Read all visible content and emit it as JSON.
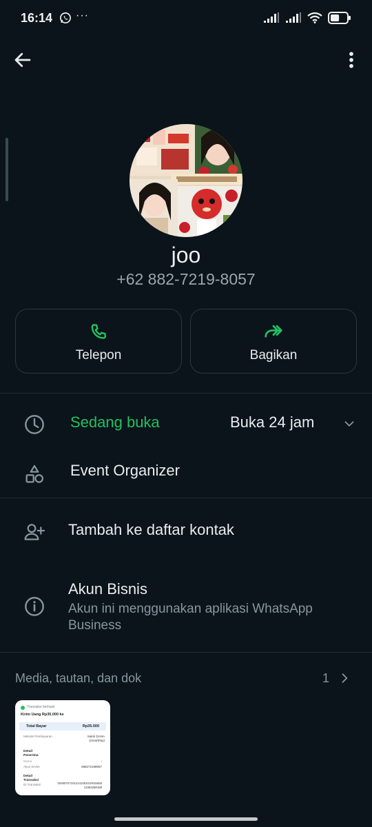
{
  "status": {
    "time": "16:14",
    "dots": "···",
    "battery_percent": 55
  },
  "contact": {
    "name": "joo",
    "phone": "+62 882-7219-8057"
  },
  "actions": {
    "call_label": "Telepon",
    "share_label": "Bagikan"
  },
  "hours": {
    "open_label": "Sedang buka",
    "value": "Buka 24 jam"
  },
  "category": {
    "label": "Event Organizer"
  },
  "add_contact": {
    "label": "Tambah ke daftar kontak"
  },
  "business": {
    "title": "Akun Bisnis",
    "subtitle": "Akun ini menggunakan aplikasi WhatsApp Business"
  },
  "media": {
    "header": "Media, tautan, dan dok",
    "count": "1",
    "thumb": {
      "status": "Transaksi berhasil",
      "title": "Kirim Uang Rp35.000 ke",
      "total_label": "Total Bayar",
      "total_value": "Rp35.000",
      "method_label": "Metode Pembayaran",
      "method_value": "Saldo DANA (SmartPay)",
      "recipient_label": "Detail Penerima",
      "name_label": "Nama",
      "name_value": "-",
      "account_label": "Akun DANA",
      "account_value": "088272198057",
      "tx_label": "Detail Transaksi",
      "tx_id_label": "ID Transaksi",
      "tx_id_value": "20260707101214100101001665513363268188"
    }
  },
  "colors": {
    "accent": "#21c063",
    "background": "#0b141a",
    "text": "#e9edef",
    "muted": "#8696a0"
  }
}
